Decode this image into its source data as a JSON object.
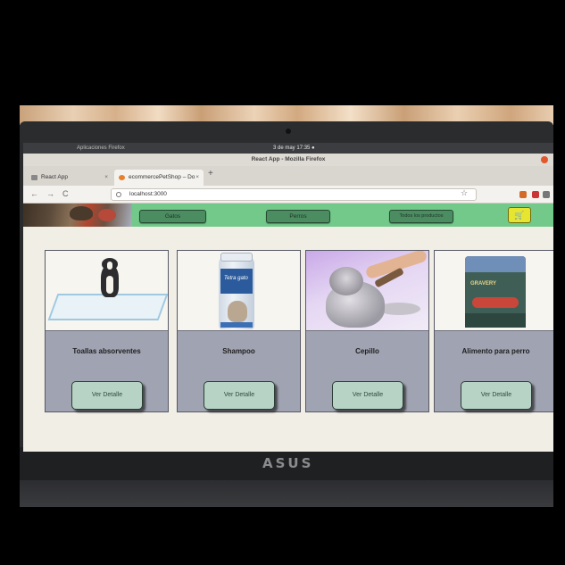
{
  "os": {
    "left_text": "Aplicaciones  Firefox",
    "clock": "3 de may  17:35 ●"
  },
  "window": {
    "title": "React App - Mozilla Firefox"
  },
  "tabs": [
    {
      "label": "React App",
      "close": "×"
    },
    {
      "label": "ecommercePetShop – Do",
      "close": "×"
    }
  ],
  "tab_plus": "+",
  "nav": {
    "back": "←",
    "forward": "→",
    "reload": "C",
    "url": "localhost:3000",
    "bookmark": "☆"
  },
  "bezel": {
    "brand": "ASUS"
  },
  "header": {
    "links": [
      {
        "label": "Gatos"
      },
      {
        "label": "Perros"
      },
      {
        "label": "Todos los productos"
      }
    ],
    "cart_icon": "cart-icon",
    "cart_glyph": "🛒"
  },
  "products": [
    {
      "name": "Toallas absorventes",
      "button": "Ver Detalle"
    },
    {
      "name": "Shampoo",
      "button": "Ver Detalle",
      "brand": "Tetra gato"
    },
    {
      "name": "Cepillo",
      "button": "Ver Detalle"
    },
    {
      "name": "Alimento para perro",
      "button": "Ver Detalle",
      "brand": "GRAVERY"
    }
  ],
  "colors": {
    "header_green": "#72c98a",
    "pill_green": "#4b8c61",
    "cart_yellow": "#e6e631",
    "card_gray": "#a0a3b1",
    "button_mint": "#b7d3c5"
  }
}
